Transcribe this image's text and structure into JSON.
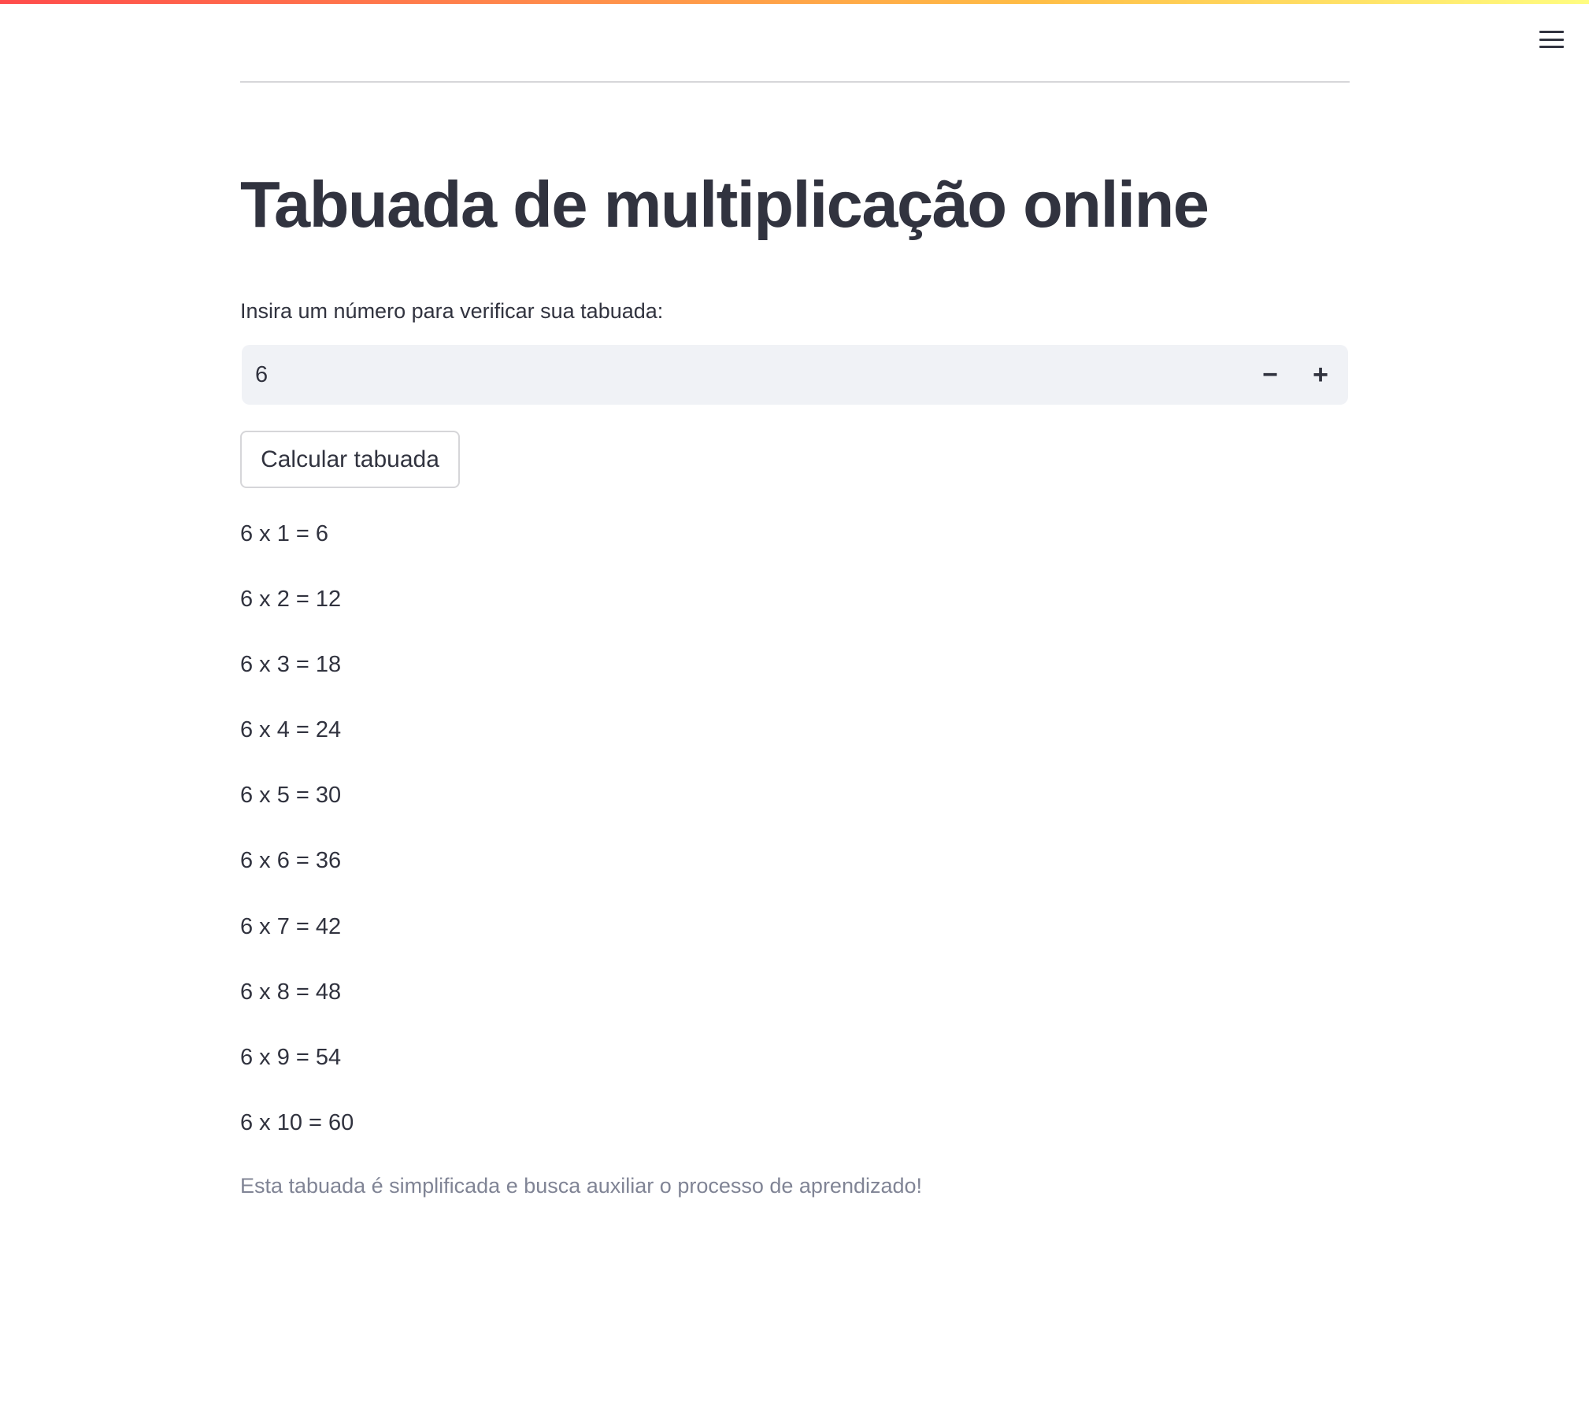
{
  "header": {
    "menu_icon": "hamburger-menu-icon"
  },
  "main": {
    "title": "Tabuada de multiplicação online",
    "input": {
      "label": "Insira um número para verificar sua tabuada:",
      "value": "6",
      "decrement_symbol": "−",
      "increment_symbol": "+"
    },
    "calculate_button_label": "Calcular tabuada",
    "results": [
      "6 x 1 = 6",
      "6 x 2 = 12",
      "6 x 3 = 18",
      "6 x 4 = 24",
      "6 x 5 = 30",
      "6 x 6 = 36",
      "6 x 7 = 42",
      "6 x 8 = 48",
      "6 x 9 = 54",
      "6 x 10 = 60"
    ],
    "caption": "Esta tabuada é simplificada e busca auxiliar o processo de aprendizado!"
  },
  "colors": {
    "text": "#31333f",
    "caption": "#808495",
    "input_background": "#f0f2f6",
    "border": "#d6d6d9",
    "accent_gradient_start": "#ff4b4b",
    "accent_gradient_end": "#fffd80"
  }
}
